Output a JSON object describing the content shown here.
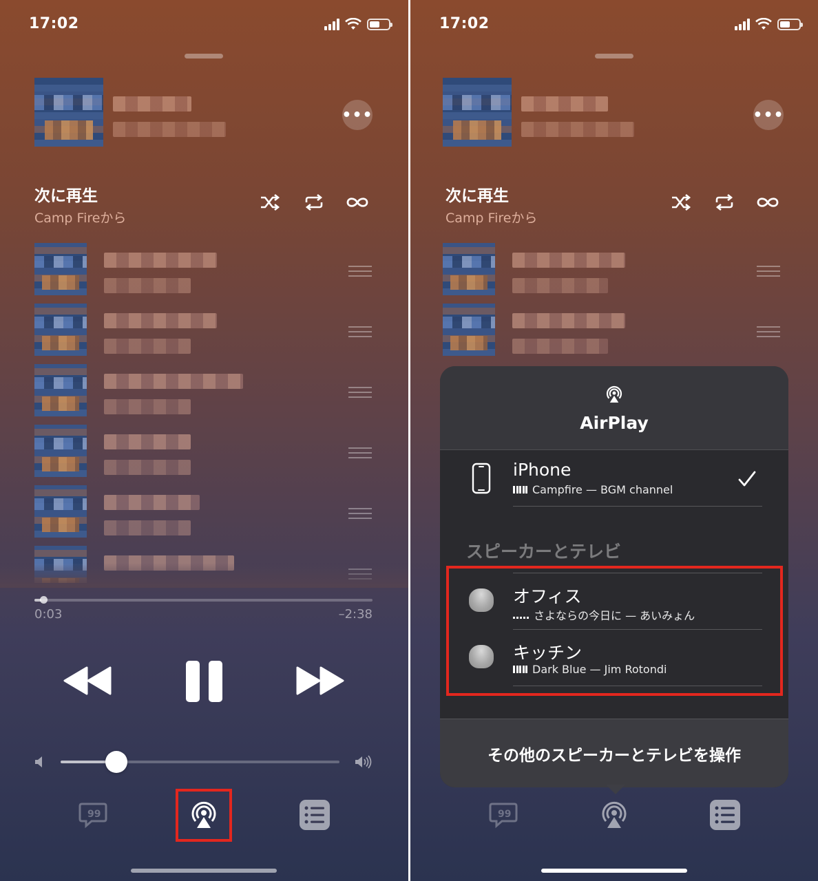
{
  "status_bar": {
    "time": "17:02"
  },
  "up_next": {
    "title": "次に再生",
    "subtitle": "Camp Fireから"
  },
  "playback": {
    "elapsed": "0:03",
    "remaining": "–2:38",
    "progress_fraction": 0.02,
    "volume_fraction": 0.2
  },
  "airplay": {
    "title": "AirPlay",
    "current_device": {
      "name": "iPhone",
      "now_playing": "Campfire — BGM channel",
      "selected": true
    },
    "section_title": "スピーカーとテレビ",
    "devices": [
      {
        "name": "オフィス",
        "now_playing": "さよならの今日に — あいみょん",
        "status": "paused"
      },
      {
        "name": "キッチン",
        "now_playing": "Dark Blue — Jim Rotondi",
        "status": "playing"
      }
    ],
    "footer_button": "その他のスピーカーとテレビを操作"
  },
  "colors": {
    "highlight": "#e3271e",
    "sheet_bg": "#2a2a2e"
  },
  "icons": [
    "shuffle-icon",
    "repeat-icon",
    "infinity-icon",
    "rewind-icon",
    "pause-icon",
    "fast-forward-icon",
    "lyrics-icon",
    "airplay-icon",
    "queue-icon",
    "checkmark-icon",
    "iphone-icon",
    "homepod-icon"
  ]
}
